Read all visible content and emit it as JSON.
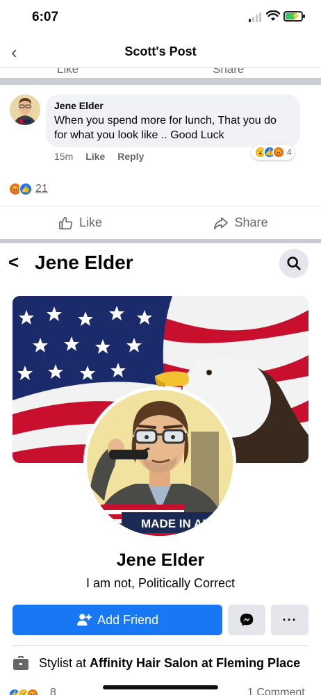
{
  "status_bar": {
    "time": "6:07"
  },
  "post_header": {
    "title": "Scott's Post"
  },
  "comment": {
    "author": "Jene Elder",
    "text": "When you spend more for lunch, That you do for what you look like .. Good Luck",
    "time": "15m",
    "like_label": "Like",
    "reply_label": "Reply",
    "reaction_count": "4",
    "reactions": [
      "wow",
      "like",
      "angry"
    ]
  },
  "post": {
    "reaction_count": "21",
    "reactions": [
      "angry",
      "like"
    ],
    "like_label": "Like",
    "share_label": "Share"
  },
  "profile": {
    "header_name": "Jene Elder",
    "name": "Jene Elder",
    "bio": "I am not,  Politically Correct",
    "add_friend_label": "Add Friend",
    "more_label": "···",
    "avatar_shirt_text": "MADE IN AME",
    "work_prefix": "Stylist at ",
    "work_place": "Affinity Hair Salon at Fleming Place"
  },
  "bottom_peek": {
    "count": "8",
    "comments": "1 Comment"
  },
  "colors": {
    "accent": "#1877f2",
    "like_blue": "#1877f2",
    "angry_orange": "#e9710f",
    "wow_yellow": "#f7b125",
    "separator": "#c9ccd1"
  }
}
